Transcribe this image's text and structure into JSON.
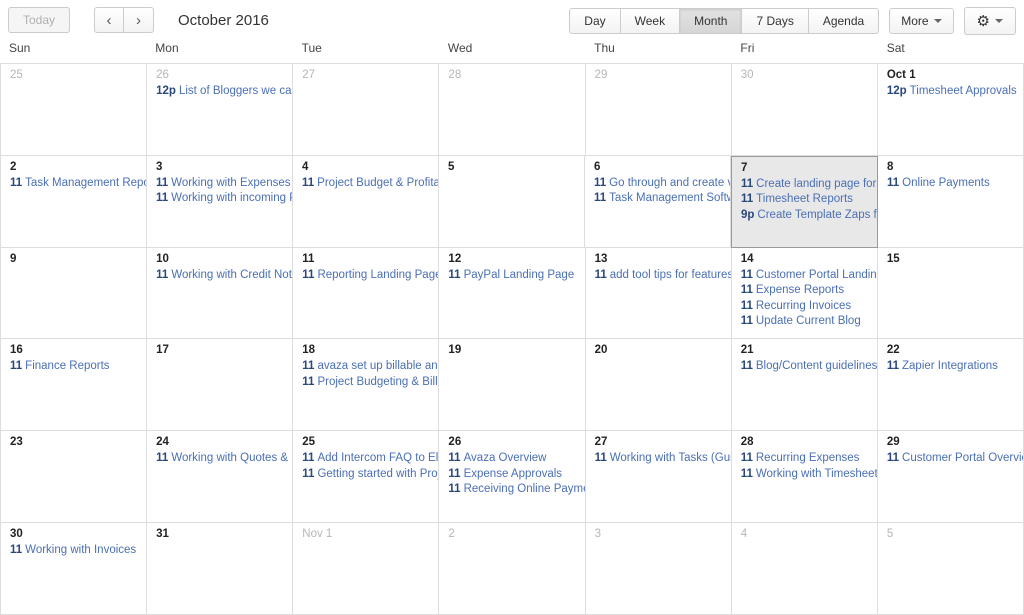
{
  "toolbar": {
    "today_label": "Today",
    "prev_label": "‹",
    "next_label": "›",
    "title": "October 2016",
    "views": [
      {
        "label": "Day",
        "active": false
      },
      {
        "label": "Week",
        "active": false
      },
      {
        "label": "Month",
        "active": true
      },
      {
        "label": "7 Days",
        "active": false
      },
      {
        "label": "Agenda",
        "active": false
      }
    ],
    "more_label": "More",
    "settings_icon": "gear-icon"
  },
  "weekdays": [
    "Sun",
    "Mon",
    "Tue",
    "Wed",
    "Thu",
    "Fri",
    "Sat"
  ],
  "weeks": [
    [
      {
        "num": "25",
        "other": true,
        "today": false,
        "events": []
      },
      {
        "num": "26",
        "other": true,
        "today": false,
        "events": [
          {
            "time": "12p",
            "title": "List of Bloggers we can Pr"
          }
        ]
      },
      {
        "num": "27",
        "other": true,
        "today": false,
        "events": []
      },
      {
        "num": "28",
        "other": true,
        "today": false,
        "events": []
      },
      {
        "num": "29",
        "other": true,
        "today": false,
        "events": []
      },
      {
        "num": "30",
        "other": true,
        "today": false,
        "events": []
      },
      {
        "num": "Oct 1",
        "other": false,
        "today": false,
        "events": [
          {
            "time": "12p",
            "title": "Timesheet Approvals"
          }
        ]
      }
    ],
    [
      {
        "num": "2",
        "other": false,
        "today": false,
        "events": [
          {
            "time": "11",
            "title": "Task Management Reports"
          }
        ]
      },
      {
        "num": "3",
        "other": false,
        "today": false,
        "events": [
          {
            "time": "11",
            "title": "Working with Expenses"
          },
          {
            "time": "11",
            "title": "Working with incoming Payr"
          }
        ]
      },
      {
        "num": "4",
        "other": false,
        "today": false,
        "events": [
          {
            "time": "11",
            "title": "Project Budget & Profitabilit"
          }
        ]
      },
      {
        "num": "5",
        "other": false,
        "today": false,
        "events": []
      },
      {
        "num": "6",
        "other": false,
        "today": false,
        "events": [
          {
            "time": "11",
            "title": "Go through and create vers"
          },
          {
            "time": "11",
            "title": "Task Management Software"
          }
        ]
      },
      {
        "num": "7",
        "other": false,
        "today": true,
        "events": [
          {
            "time": "11",
            "title": "Create landing page for Pro"
          },
          {
            "time": "11",
            "title": "Timesheet Reports"
          },
          {
            "time": "9p",
            "title": "Create Template Zaps for th"
          }
        ]
      },
      {
        "num": "8",
        "other": false,
        "today": false,
        "events": [
          {
            "time": "11",
            "title": "Online Payments"
          }
        ]
      }
    ],
    [
      {
        "num": "9",
        "other": false,
        "today": false,
        "events": []
      },
      {
        "num": "10",
        "other": false,
        "today": false,
        "events": [
          {
            "time": "11",
            "title": "Working with Credit Notes"
          }
        ]
      },
      {
        "num": "11",
        "other": false,
        "today": false,
        "events": [
          {
            "time": "11",
            "title": "Reporting Landing Page"
          }
        ]
      },
      {
        "num": "12",
        "other": false,
        "today": false,
        "events": [
          {
            "time": "11",
            "title": "PayPal Landing Page"
          }
        ]
      },
      {
        "num": "13",
        "other": false,
        "today": false,
        "events": [
          {
            "time": "11",
            "title": "add tool tips for features on"
          }
        ]
      },
      {
        "num": "14",
        "other": false,
        "today": false,
        "events": [
          {
            "time": "11",
            "title": "Customer Portal Landing Pa"
          },
          {
            "time": "11",
            "title": "Expense Reports"
          },
          {
            "time": "11",
            "title": "Recurring Invoices"
          },
          {
            "time": "11",
            "title": "Update Current Blog"
          }
        ]
      },
      {
        "num": "15",
        "other": false,
        "today": false,
        "events": []
      }
    ],
    [
      {
        "num": "16",
        "other": false,
        "today": false,
        "events": [
          {
            "time": "11",
            "title": "Finance Reports"
          }
        ]
      },
      {
        "num": "17",
        "other": false,
        "today": false,
        "events": []
      },
      {
        "num": "18",
        "other": false,
        "today": false,
        "events": [
          {
            "time": "11",
            "title": "avaza set up billable and co"
          },
          {
            "time": "11",
            "title": "Project Budgeting & Billing /"
          }
        ]
      },
      {
        "num": "19",
        "other": false,
        "today": false,
        "events": []
      },
      {
        "num": "20",
        "other": false,
        "today": false,
        "events": []
      },
      {
        "num": "21",
        "other": false,
        "today": false,
        "events": [
          {
            "time": "11",
            "title": "Blog/Content guidelines"
          }
        ]
      },
      {
        "num": "22",
        "other": false,
        "today": false,
        "events": [
          {
            "time": "11",
            "title": "Zapier Integrations"
          }
        ]
      }
    ],
    [
      {
        "num": "23",
        "other": false,
        "today": false,
        "events": []
      },
      {
        "num": "24",
        "other": false,
        "today": false,
        "events": [
          {
            "time": "11",
            "title": "Working with Quotes & Esti"
          }
        ]
      },
      {
        "num": "25",
        "other": false,
        "today": false,
        "events": [
          {
            "time": "11",
            "title": "Add Intercom FAQ to Elev.io"
          },
          {
            "time": "11",
            "title": "Getting started with Projects"
          }
        ]
      },
      {
        "num": "26",
        "other": false,
        "today": false,
        "events": [
          {
            "time": "11",
            "title": "Avaza Overview"
          },
          {
            "time": "11",
            "title": "Expense Approvals"
          },
          {
            "time": "11",
            "title": "Receiving Online Payments"
          }
        ]
      },
      {
        "num": "27",
        "other": false,
        "today": false,
        "events": [
          {
            "time": "11",
            "title": "Working with Tasks (Guide t"
          }
        ]
      },
      {
        "num": "28",
        "other": false,
        "today": false,
        "events": [
          {
            "time": "11",
            "title": "Recurring Expenses"
          },
          {
            "time": "11",
            "title": "Working with Timesheets"
          }
        ]
      },
      {
        "num": "29",
        "other": false,
        "today": false,
        "events": [
          {
            "time": "11",
            "title": "Customer Portal Overview"
          }
        ]
      }
    ],
    [
      {
        "num": "30",
        "other": false,
        "today": false,
        "events": [
          {
            "time": "11",
            "title": "Working with Invoices"
          }
        ]
      },
      {
        "num": "31",
        "other": false,
        "today": false,
        "events": []
      },
      {
        "num": "Nov 1",
        "other": true,
        "today": false,
        "events": []
      },
      {
        "num": "2",
        "other": true,
        "today": false,
        "events": []
      },
      {
        "num": "3",
        "other": true,
        "today": false,
        "events": []
      },
      {
        "num": "4",
        "other": true,
        "today": false,
        "events": []
      },
      {
        "num": "5",
        "other": true,
        "today": false,
        "events": []
      }
    ]
  ],
  "colors": {
    "event_text": "#3b5ca0",
    "event_time": "#29487d",
    "today_bg": "#e8e8e8",
    "grid_line": "#dddddd",
    "other_month_num": "#b6b6b6"
  }
}
